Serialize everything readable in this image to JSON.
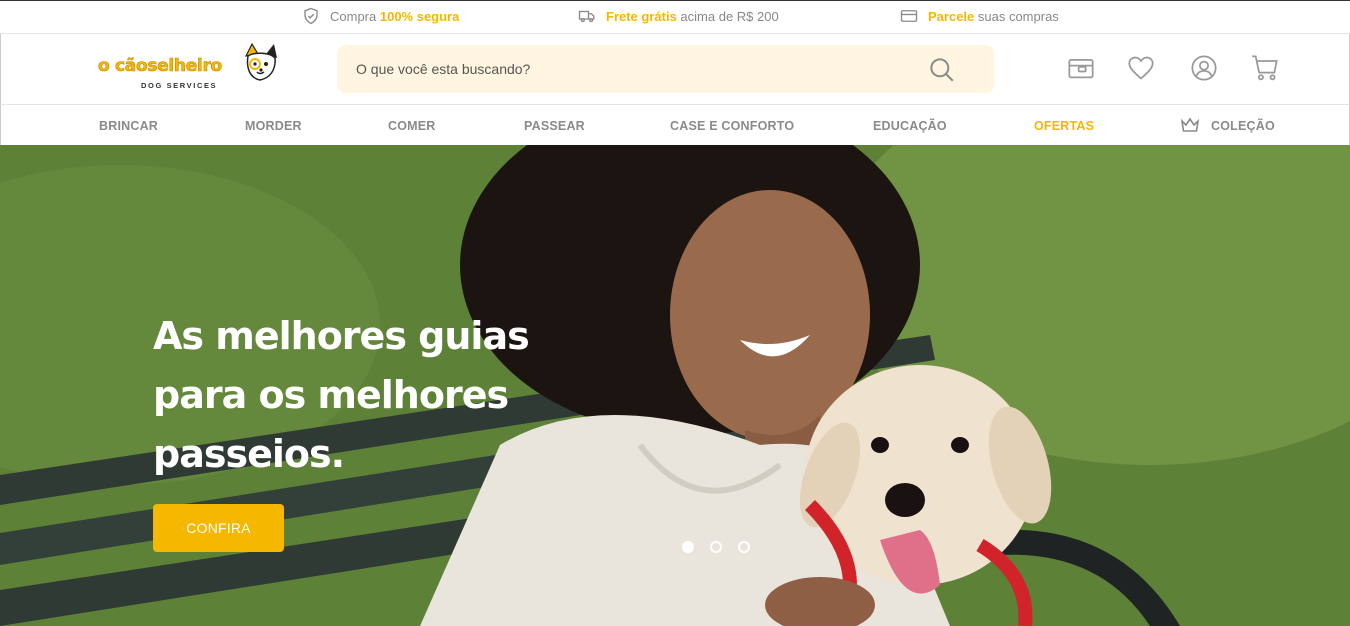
{
  "topbar": {
    "secure": {
      "prefix": "Compra ",
      "highlight": "100% segura",
      "icon": "shield-icon"
    },
    "shipping": {
      "highlight": "Frete grátis",
      "suffix": " acima de R$ 200",
      "icon": "truck-icon"
    },
    "installments": {
      "highlight": "Parcele",
      "suffix": " suas compras",
      "icon": "credit-card-icon"
    }
  },
  "brand": {
    "name": "o cãoselheiro",
    "tagline": "DOG SERVICES",
    "accent": "#f6b700"
  },
  "search": {
    "placeholder": "O que você esta buscando?",
    "value": "",
    "icon": "search-icon"
  },
  "header_icons": [
    "wallet-icon",
    "heart-icon",
    "user-icon",
    "cart-icon"
  ],
  "nav": {
    "items": [
      {
        "label": "BRINCAR"
      },
      {
        "label": "MORDER"
      },
      {
        "label": "COMER"
      },
      {
        "label": "PASSEAR"
      },
      {
        "label": "CASE E CONFORTO"
      },
      {
        "label": "EDUCAÇÃO"
      },
      {
        "label": "OFERTAS",
        "highlighted": true
      },
      {
        "label": "COLEÇÃO",
        "icon": "crown-icon"
      }
    ]
  },
  "hero": {
    "title_lines": [
      "As melhores guias",
      "para os melhores",
      "passeios."
    ],
    "button_label": "CONFIRA",
    "slides": 3,
    "active_slide": 1
  }
}
